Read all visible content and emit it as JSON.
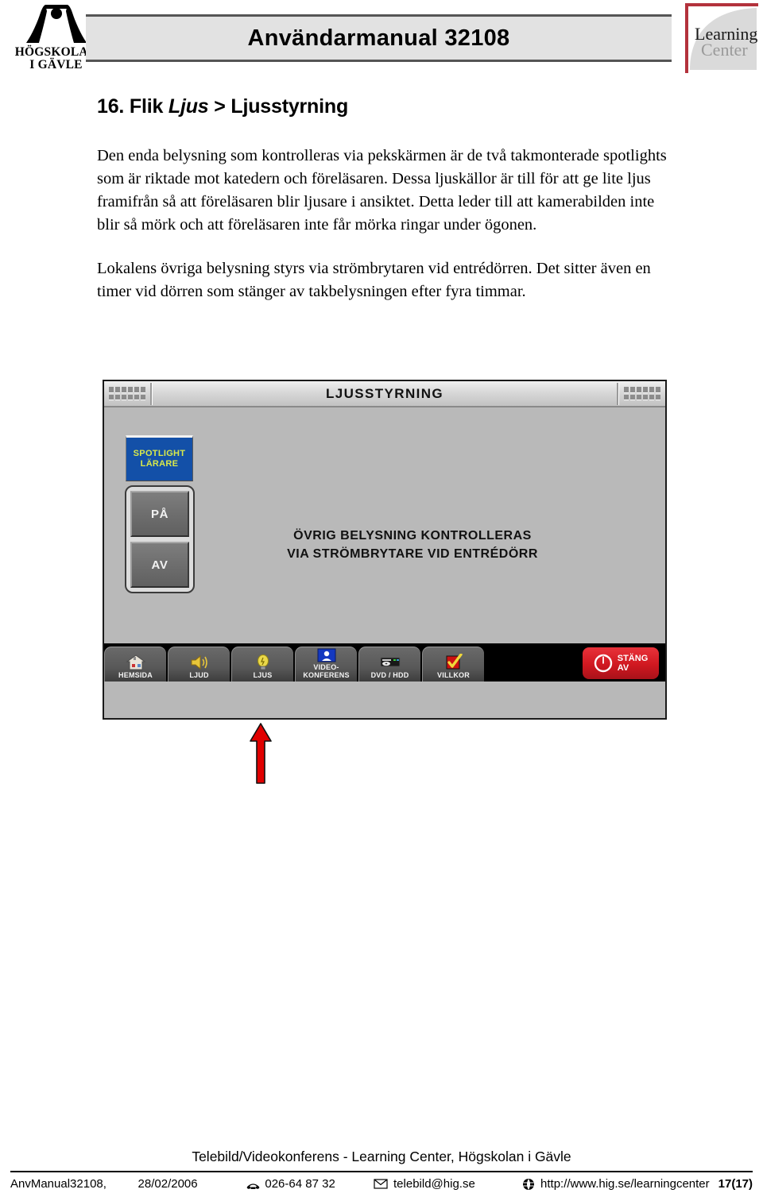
{
  "header": {
    "doc_title": "Användarmanual 32108",
    "university_logo_line1": "HÖGSKOLAN",
    "university_logo_line2": "I GÄVLE",
    "lc_logo_line1": "Learning",
    "lc_logo_line2": "Center"
  },
  "content": {
    "heading_number": "16. Flik ",
    "heading_italic": "Ljus",
    "heading_rest": " > Ljusstyrning",
    "paragraph_1": "Den enda belysning som kontrolleras via pekskärmen är de två takmonterade spotlights som är riktade mot katedern och föreläsaren. Dessa ljuskällor är till för att ge lite ljus framifrån så att föreläsaren blir ljusare i ansiktet. Detta leder till att kamerabilden inte blir så mörk och att föreläsaren inte får mörka ringar under ögonen.",
    "paragraph_2": "Lokalens övriga belysning styrs via strömbrytaren vid entrédörren. Det sitter även en timer vid dörren som stänger av takbelysningen efter fyra timmar."
  },
  "touchscreen": {
    "title": "LJUSSTYRNING",
    "spotlight_button_line1": "SPOTLIGHT",
    "spotlight_button_line2": "LÄRARE",
    "toggle_on": "PÅ",
    "toggle_off": "AV",
    "center_note_line1": "ÖVRIG BELYSNING KONTROLLERAS",
    "center_note_line2": "VIA STRÖMBRYTARE VID ENTRÉDÖRR",
    "colors": {
      "spotlight_bg": "#1350a8",
      "spotlight_text": "#d9e94a",
      "screen_bg": "#b9b9b9",
      "taskbar_bg": "#000000",
      "power_red": "#d01820"
    },
    "taskbar": [
      {
        "label": "HEMSIDA",
        "icon": "house-icon"
      },
      {
        "label": "LJUD",
        "icon": "speaker-icon"
      },
      {
        "label": "LJUS",
        "icon": "lightbulb-icon"
      },
      {
        "label_line1": "VIDEO-",
        "label_line2": "KONFERENS",
        "icon": "video-conference-icon"
      },
      {
        "label": "DVD / HDD",
        "icon": "dvd-player-icon"
      },
      {
        "label": "VILLKOR",
        "icon": "checkmark-icon"
      }
    ],
    "power_button": {
      "line1": "STÄNG",
      "line2": "AV",
      "icon": "power-icon"
    }
  },
  "annotation": {
    "arrow": "red-up-arrow",
    "arrow_color": "#e00000"
  },
  "footer": {
    "organization": "Telebild/Videokonferens - Learning Center, Högskolan i Gävle",
    "doc_id": "AnvManual32108,",
    "date": "28/02/2006",
    "phone": "026-64 87 32",
    "email": "telebild@hig.se",
    "website": "http://www.hig.se/learningcenter",
    "page": "17(17)"
  }
}
